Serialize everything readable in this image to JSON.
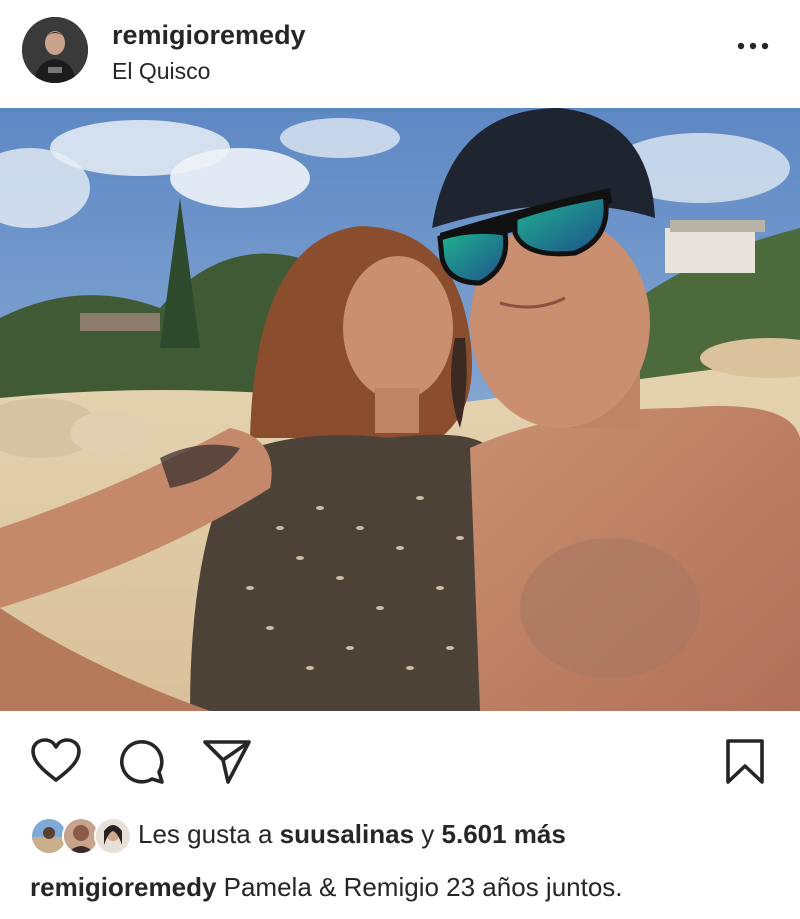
{
  "post": {
    "username": "remigioremedy",
    "location": "El Quisco"
  },
  "icons": {
    "more": "more-horizontal-icon",
    "like": "heart-icon",
    "comment": "comment-icon",
    "share": "send-icon",
    "save": "bookmark-icon"
  },
  "likes": {
    "prefix": "Les gusta a ",
    "user": "suusalinas",
    "connector": " y ",
    "count": "5.601 más"
  },
  "caption": {
    "username": "remigioremedy",
    "text": " Pamela & Remigio  23 años juntos."
  },
  "colors": {
    "text": "#262626",
    "background": "#ffffff"
  }
}
